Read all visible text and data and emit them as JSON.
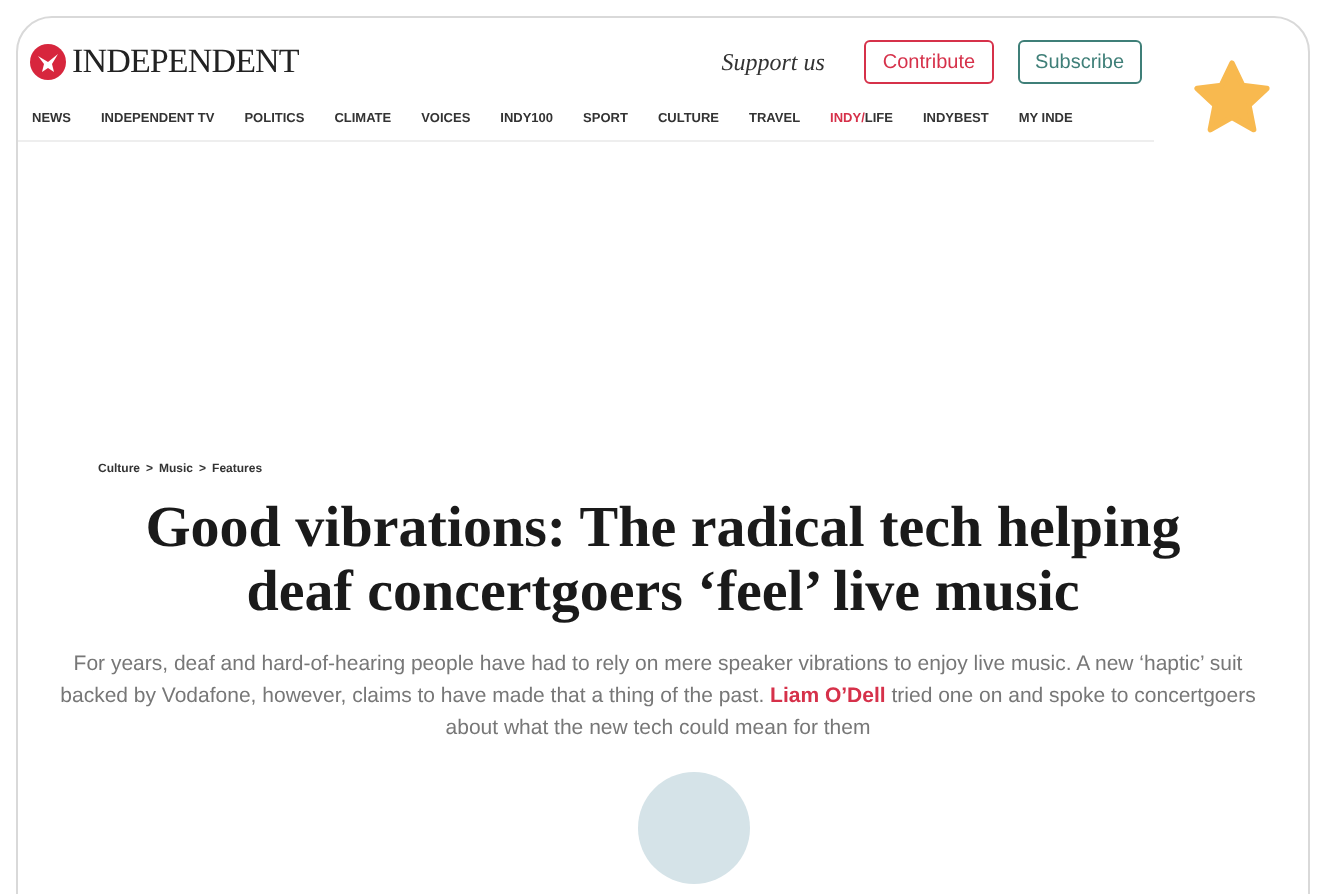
{
  "header": {
    "logo": "INDEPENDENT",
    "support": "Support us",
    "buttons": [
      {
        "label": "Contribute",
        "color": "#d6314a"
      },
      {
        "label": "Subscribe",
        "color": "#3f7f78"
      }
    ]
  },
  "nav": [
    {
      "label": "NEWS"
    },
    {
      "label": "INDEPENDENT TV"
    },
    {
      "label": "POLITICS"
    },
    {
      "label": "CLIMATE"
    },
    {
      "label": "VOICES"
    },
    {
      "label": "INDY100"
    },
    {
      "label": "SPORT"
    },
    {
      "label": "CULTURE"
    },
    {
      "label": "TRAVEL"
    },
    {
      "prefix": "INDY/",
      "label": "LIFE"
    },
    {
      "label": "INDYBEST"
    },
    {
      "label": "MY INDE"
    }
  ],
  "article": {
    "breadcrumbs": [
      "Culture",
      "Music",
      "Features"
    ],
    "separator": ">",
    "headline": "Good vibrations: The radical tech helping deaf concertgoers ‘feel’ live music",
    "standfirst": "For years, deaf and hard-of-hearing people have had to rely on mere speaker vibrations to enjoy live music. A new ‘haptic’ suit backed by Vodafone, however, claims to have made that a thing of the past.",
    "author": "Liam O’Dell",
    "standfirst_end": "tried one on and spoke to concertgoers about what the new tech could mean for them"
  }
}
